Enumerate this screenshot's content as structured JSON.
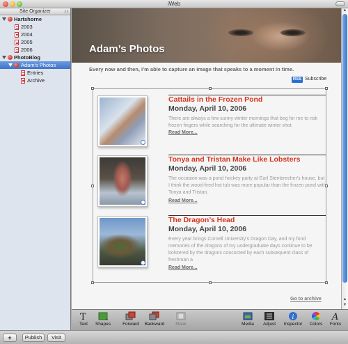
{
  "window": {
    "title": "iWeb"
  },
  "sidebar": {
    "header": "Site Organizer",
    "items": [
      {
        "label": "Hartshorne",
        "type": "site"
      },
      {
        "label": "2003",
        "type": "page"
      },
      {
        "label": "2004",
        "type": "page"
      },
      {
        "label": "2005",
        "type": "page"
      },
      {
        "label": "2006",
        "type": "page"
      },
      {
        "label": "PhotoBlog",
        "type": "site"
      },
      {
        "label": "Adam's Photos",
        "type": "blog",
        "selected": true
      },
      {
        "label": "Entries",
        "type": "subpage"
      },
      {
        "label": "Archive",
        "type": "subpage"
      }
    ]
  },
  "bottom_bar": {
    "add_label": "+",
    "publish_label": "Publish",
    "visit_label": "Visit"
  },
  "page": {
    "title": "Adam’s Photos",
    "intro": "Every now and then, I’m able to capture an image that speaks to a moment in time.",
    "rss_badge": "RSS",
    "subscribe": "Subscribe",
    "archive_link": "Go to archive",
    "entries": [
      {
        "title": "Cattails in the Frozen Pond",
        "date": "Monday, April 10, 2006",
        "body": "There are always a few sunny winter mornings that beg for me to risk frozen fingers while searching for the ultimate winter shot.",
        "more": "Read More..."
      },
      {
        "title": "Tonya and Tristan Make Like Lobsters",
        "date": "Monday, April 10, 2006",
        "body": "The occasion was a pond hockey party at Earl Steinbrecher's house, but I think the wood-fired hot tub was more popular than the frozen pond with Tonya and Tristan.",
        "more": "Read More..."
      },
      {
        "title": "The Dragon’s Head",
        "date": "Monday, April 10, 2006",
        "body": "Every year brings Cornell University's Dragon Day, and my fond memories of the dragons of my undergraduate days continue to be bolstered by the dragons concocted by each subsequent class of freshman a",
        "more": "Read More..."
      }
    ]
  },
  "toolbar": {
    "text": "Text",
    "shapes": "Shapes",
    "forward": "Forward",
    "backward": "Backward",
    "mask": "Mask",
    "media": "Media",
    "adjust": "Adjust",
    "inspector": "Inspector",
    "colors": "Colors",
    "fonts": "Fonts"
  }
}
